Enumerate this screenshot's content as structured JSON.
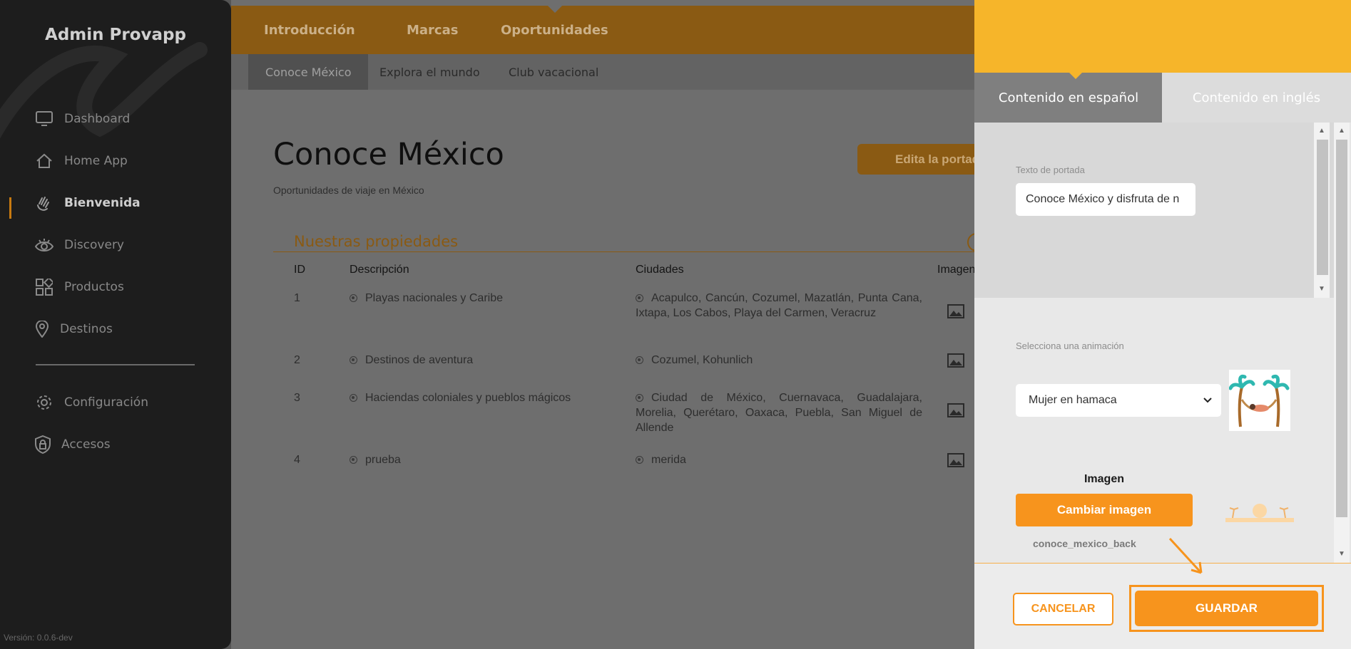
{
  "app": {
    "brand": "Admin Provapp",
    "version": "Versión: 0.0.6-dev"
  },
  "sidebar": {
    "items": [
      {
        "label": "Dashboard",
        "icon": "monitor-icon"
      },
      {
        "label": "Home App",
        "icon": "home-icon"
      },
      {
        "label": "Bienvenida",
        "icon": "waving-hand-icon",
        "active": true
      },
      {
        "label": "Discovery",
        "icon": "eye-icon"
      },
      {
        "label": "Productos",
        "icon": "grid-shapes-icon"
      },
      {
        "label": "Destinos",
        "icon": "map-pin-icon"
      }
    ],
    "bottom_items": [
      {
        "label": "Configuración",
        "icon": "gear-icon"
      },
      {
        "label": "Accesos",
        "icon": "shield-lock-icon"
      }
    ]
  },
  "topnav": {
    "items": [
      "Introducción",
      "Marcas",
      "Oportunidades"
    ]
  },
  "subnav": {
    "items": [
      "Conoce México",
      "Explora el mundo",
      "Club vacacional"
    ]
  },
  "page": {
    "title": "Conoce México",
    "subtitle": "Oportunidades de viaje en México",
    "edit_button": "Edita la portada"
  },
  "properties": {
    "section_title": "Nuestras propiedades",
    "columns": {
      "id": "ID",
      "description": "Descripción",
      "cities": "Ciudades",
      "image": "Imagen"
    },
    "rows": [
      {
        "id": "1",
        "description": "Playas nacionales y Caribe",
        "cities": "Acapulco, Cancún, Cozumel, Mazatlán, Punta Cana, Ixtapa, Los Cabos, Playa del Carmen, Veracruz"
      },
      {
        "id": "2",
        "description": "Destinos de aventura",
        "cities": "Cozumel, Kohunlich"
      },
      {
        "id": "3",
        "description": "Haciendas coloniales y pueblos mágicos",
        "cities": "Ciudad de México, Cuernavaca, Guadalajara, Morelia, Querétaro, Oaxaca, Puebla, San Miguel de Allende"
      },
      {
        "id": "4",
        "description": "prueba",
        "cities": "merida"
      }
    ]
  },
  "panel": {
    "tabs": [
      "Contenido en español",
      "Contenido en inglés"
    ],
    "cover_text_label": "Texto de portada",
    "cover_text_value": "Conoce México y disfruta de n",
    "animation_label": "Selecciona una animación",
    "animation_value": "Mujer en hamaca",
    "image_label": "Imagen",
    "change_image_button": "Cambiar imagen",
    "image_filename": "conoce_mexico_back",
    "cancel_button": "CANCELAR",
    "save_button": "GUARDAR"
  },
  "colors": {
    "accent": "#f7941d",
    "header_yellow": "#f6b52a",
    "sidebar_bg": "#1d1d1d"
  }
}
